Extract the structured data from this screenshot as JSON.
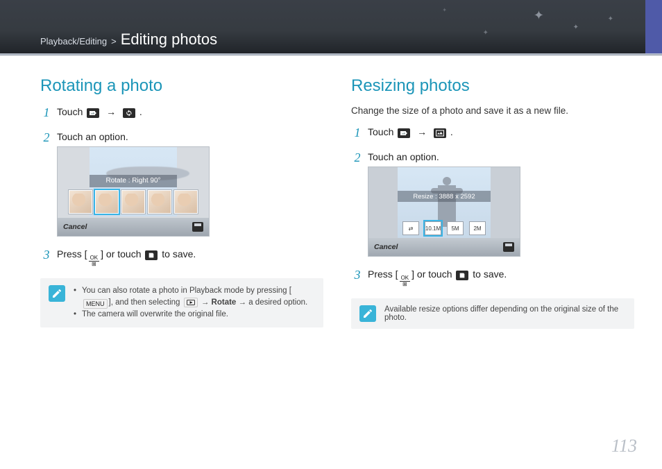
{
  "header": {
    "crumb_section": "Playback/Editing",
    "crumb_sep": ">",
    "title": "Editing photos"
  },
  "left": {
    "section_title": "Rotating a photo",
    "steps": {
      "s1_a": "Touch ",
      "s1_b": " → ",
      "s1_c": ".",
      "s2": "Touch an option.",
      "shot_banner": "Rotate : Right 90°",
      "shot_cancel": "Cancel",
      "s3_a": "Press [",
      "s3_ok_top": "OK",
      "s3_ok_bot": "⊞",
      "s3_b": "] or touch ",
      "s3_c": " to save."
    },
    "note": {
      "li1_a": "You can also rotate a photo in Playback mode by pressing [",
      "li1_menu": "MENU",
      "li1_b": "], and then selecting ",
      "li1_c": " → ",
      "li1_rotate": "Rotate",
      "li1_d": " → a desired option.",
      "li2": "The camera will overwrite the original file."
    }
  },
  "right": {
    "section_title": "Resizing photos",
    "intro": "Change the size of a photo and save it as a new file.",
    "steps": {
      "s1_a": "Touch ",
      "s1_b": " → ",
      "s1_c": ".",
      "s2": "Touch an option.",
      "shot_banner": "Resize : 3888 x 2592",
      "shot_cancel": "Cancel",
      "opt1": "⇄",
      "opt2": "10.1M",
      "opt3": "5M",
      "opt4": "2M",
      "s3_a": "Press [",
      "s3_ok_top": "OK",
      "s3_ok_bot": "⊞",
      "s3_b": "] or touch ",
      "s3_c": " to save."
    },
    "note": "Available resize options differ depending on the original size of the photo."
  },
  "page_number": "113"
}
